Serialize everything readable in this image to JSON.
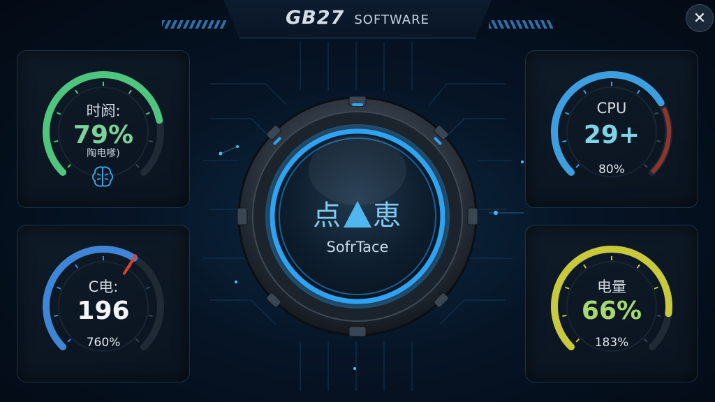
{
  "header": {
    "brand": "GB27",
    "subtitle": "SOFTWARE",
    "close_label": "✕"
  },
  "gauges": {
    "top_left": {
      "label": "时阏:",
      "value": "79%",
      "sub": "陶电嗲)",
      "level": 0.79,
      "color": "#4ec67e",
      "icon": "brain-icon"
    },
    "bottom_left": {
      "label": "C电:",
      "value": "196",
      "sub": "760%",
      "level": 0.62,
      "color": "#3f86d6",
      "needle_color": "#e0402e"
    },
    "top_right": {
      "label": "CPU",
      "value": "29+",
      "sub": "80%",
      "level": 0.72,
      "color": "#3e9fe0",
      "track_warn": "#c23a2a"
    },
    "bottom_right": {
      "label": "电量",
      "value": "66%",
      "sub": "183%",
      "level": 0.86,
      "color": "#c9c93c"
    }
  },
  "center": {
    "left_char": "点",
    "right_char": "恵",
    "caption": "SofrTace",
    "ring_color": "#2ea3f2"
  },
  "colors": {
    "value_green": "#7bd39a",
    "value_white": "#f2f6fa",
    "value_cyan": "#7fd4e6",
    "value_lime": "#a9d96e"
  }
}
